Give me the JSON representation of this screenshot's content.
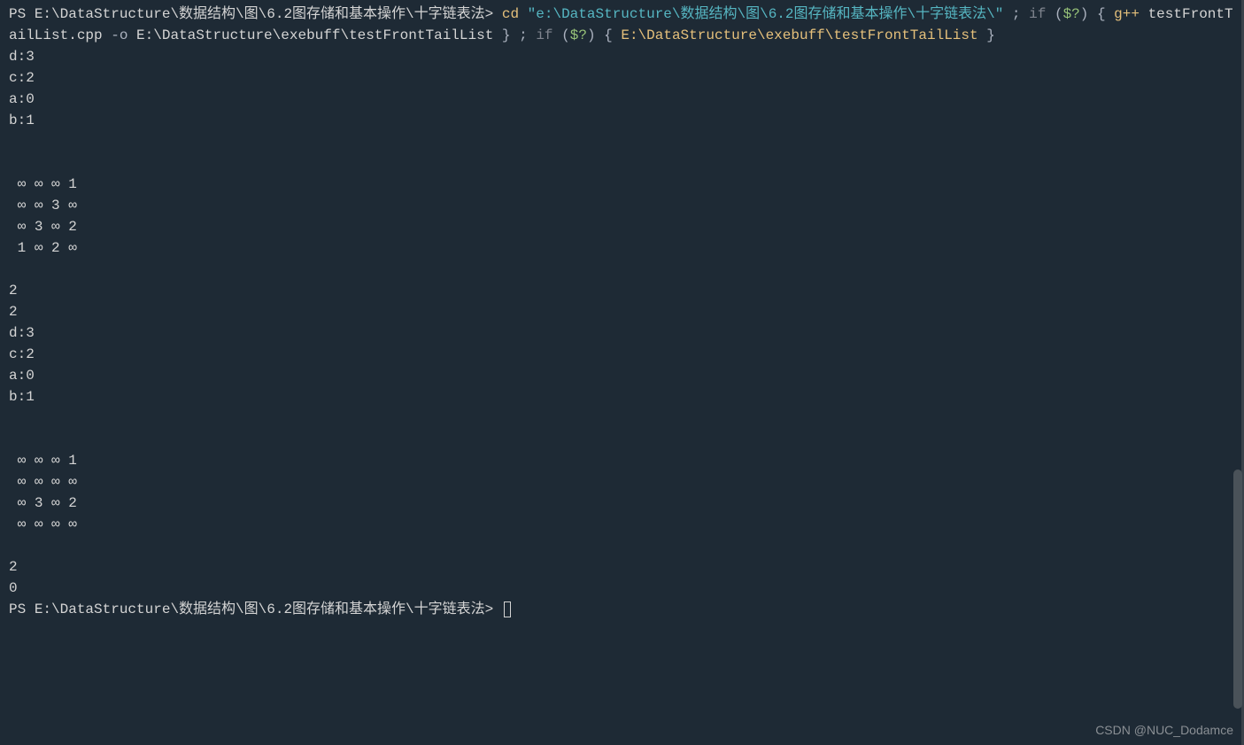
{
  "prompt1": {
    "ps": "PS ",
    "path": "E:\\DataStructure\\数据结构\\图\\6.2图存储和基本操作\\十字链表法",
    "gt": "> ",
    "cmd_cd": "cd ",
    "cd_arg": "\"e:\\DataStructure\\数据结构\\图\\6.2图存储和基本操作\\十字链表法\\\"",
    "sep1": " ; ",
    "if1": "if ",
    "paren_open1": "(",
    "var1": "$?",
    "paren_close1": ") ",
    "brace_open1": "{ ",
    "gpp": "g++ ",
    "src": "testFrontTailList.cpp ",
    "flag_o": "-o ",
    "out_path": "E:\\DataStructure\\exebuff\\testFrontTailList ",
    "brace_close1": "} ",
    "sep2": "; ",
    "if2": "if ",
    "paren_open2": "(",
    "var2": "$?",
    "paren_close2": ") ",
    "brace_open2": "{ ",
    "exe_path": "E:\\DataStructure\\exebuff\\testFrontTailList ",
    "brace_close2": "}"
  },
  "output_lines": [
    "d:3",
    "c:2",
    "a:0",
    "b:1",
    "",
    "",
    " ∞ ∞ ∞ 1",
    " ∞ ∞ 3 ∞",
    " ∞ 3 ∞ 2",
    " 1 ∞ 2 ∞",
    "",
    "2",
    "2",
    "d:3",
    "c:2",
    "a:0",
    "b:1",
    "",
    "",
    " ∞ ∞ ∞ 1",
    " ∞ ∞ ∞ ∞",
    " ∞ 3 ∞ 2",
    " ∞ ∞ ∞ ∞",
    "",
    "2",
    "0"
  ],
  "prompt2": {
    "ps": "PS ",
    "path": "E:\\DataStructure\\数据结构\\图\\6.2图存储和基本操作\\十字链表法",
    "gt": "> "
  },
  "watermark": "CSDN @NUC_Dodamce"
}
